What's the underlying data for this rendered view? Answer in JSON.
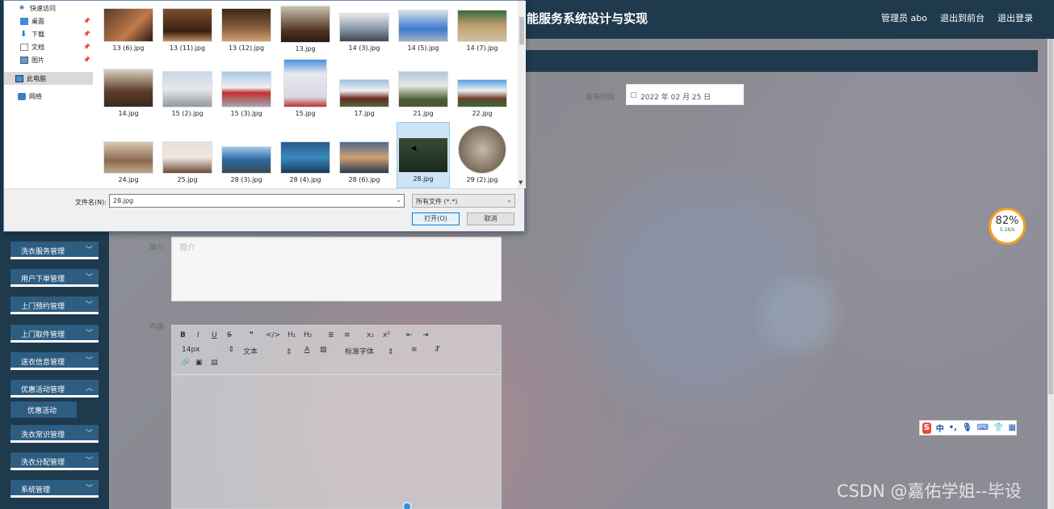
{
  "header": {
    "title": "能服务系统设计与实现",
    "links": [
      "管理员 abo",
      "退出到前台",
      "退出登录"
    ]
  },
  "sidebar": {
    "items": [
      {
        "label": "洗衣服务管理"
      },
      {
        "label": "用户下单管理"
      },
      {
        "label": "上门预约管理"
      },
      {
        "label": "上门取件管理"
      },
      {
        "label": "送衣信息管理"
      },
      {
        "label": "优惠活动管理"
      },
      {
        "label": "洗衣常识管理"
      },
      {
        "label": "洗衣分配管理"
      },
      {
        "label": "系统管理"
      }
    ],
    "active_sub": "优惠活动"
  },
  "form": {
    "publish_time_label": "发布时间",
    "publish_time_value": "2022 年 02 月 25 日",
    "intro_label": "简介",
    "intro_placeholder": "简介",
    "content_label": "内容"
  },
  "editor": {
    "font_size": "14px",
    "paragraph": "文本",
    "font_family": "标准字体",
    "buttons": [
      "B",
      "I",
      "U",
      "S",
      "❞",
      "</>",
      "H₁",
      "H₂",
      "≣",
      "≡",
      "x₂",
      "x²",
      "⇤",
      "⇥"
    ]
  },
  "file_dialog": {
    "nav": [
      {
        "label": "快速访问",
        "icon": "star-icon"
      },
      {
        "label": "桌面",
        "icon": "desktop-icon"
      },
      {
        "label": "下载",
        "icon": "download-icon"
      },
      {
        "label": "文档",
        "icon": "document-icon"
      },
      {
        "label": "图片",
        "icon": "pictures-icon"
      },
      {
        "label": "此电脑",
        "icon": "computer-icon"
      },
      {
        "label": "网络",
        "icon": "network-icon"
      }
    ],
    "files": [
      "13 (6).jpg",
      "13 (11).jpg",
      "13 (12).jpg",
      "13.jpg",
      "14 (3).jpg",
      "14 (5).jpg",
      "14 (7).jpg",
      "14.jpg",
      "15 (2).jpg",
      "15 (3).jpg",
      "15.jpg",
      "17.jpg",
      "21.jpg",
      "22.jpg",
      "24.jpg",
      "25.jpg",
      "28 (3).jpg",
      "28 (4).jpg",
      "28 (6).jpg",
      "28.jpg",
      "29 (2).jpg"
    ],
    "selected_file": "28.jpg",
    "filename_label": "文件名(N):",
    "filename_value": "28.jpg",
    "filetype_value": "所有文件 (*.*)",
    "open_button": "打开(O)",
    "cancel_button": "取消"
  },
  "speed_widget": {
    "percent": "82%",
    "rate": "5.1K/s"
  },
  "ime": {
    "logo": "S",
    "mode": "中"
  },
  "watermark": "CSDN @嘉佑学姐--毕设"
}
